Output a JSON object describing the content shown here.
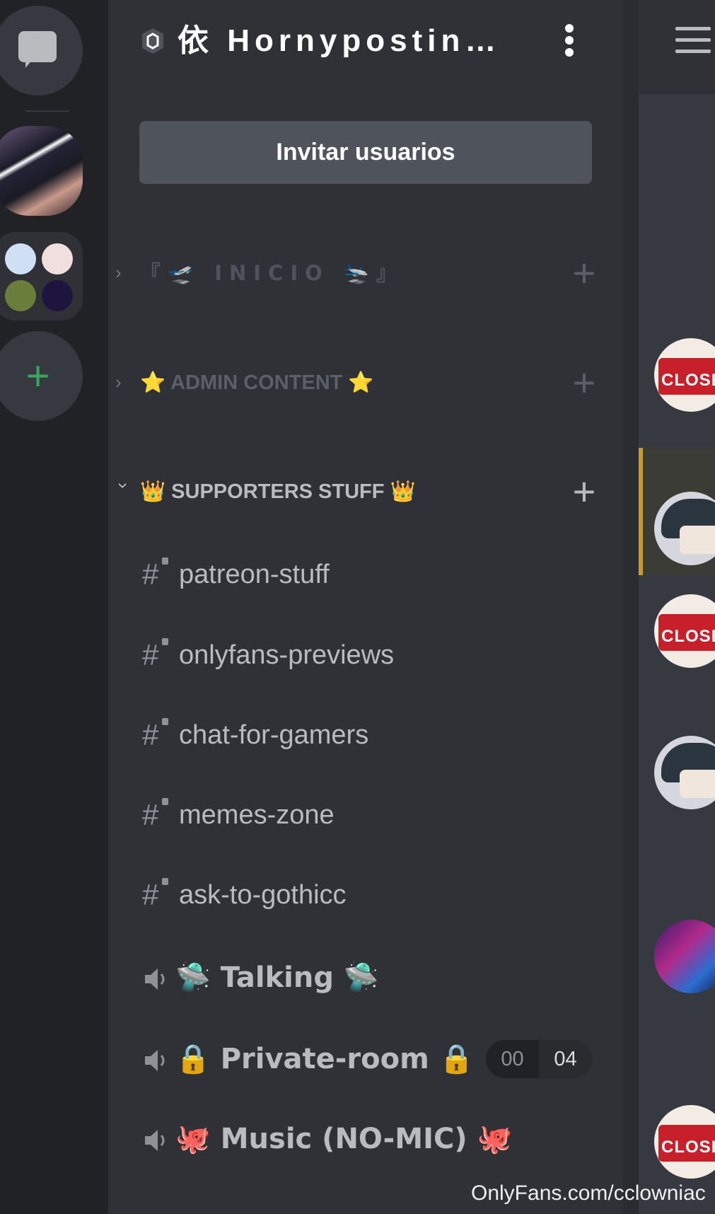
{
  "server": {
    "name": "依 Hornypostin…",
    "invite_label": "Invitar usuarios"
  },
  "categories": [
    {
      "label": "『🛫 INICIO 🛬』",
      "collapsed": true
    },
    {
      "label": "⭐ ADMIN CONTENT ⭐",
      "collapsed": true
    },
    {
      "label": "👑 SUPPORTERS STUFF 👑",
      "collapsed": false
    }
  ],
  "text_channels": [
    {
      "label": "patreon-stuff",
      "locked": true
    },
    {
      "label": "onlyfans-previews",
      "locked": true
    },
    {
      "label": "chat-for-gamers",
      "locked": true
    },
    {
      "label": "memes-zone",
      "locked": true
    },
    {
      "label": "ask-to-gothicc",
      "locked": true
    }
  ],
  "voice_channels": [
    {
      "label": "🛸 Talking 🛸"
    },
    {
      "label": "🔒 Private-room 🔒",
      "user_count": "00",
      "user_limit": "04"
    },
    {
      "label": "🐙 Music (NO-MIC) 🐙"
    }
  ],
  "icons": {
    "direct_messages": "chat-bubble-icon",
    "add_server": "plus-icon",
    "server_badge": "shield-icon",
    "menu": "kebab-icon",
    "members": "hamburger-icon",
    "voice": "speaker-icon",
    "text": "hash-lock-icon"
  },
  "colors": {
    "accent_green": "#3ba55d",
    "panel": "#2f3136",
    "rail": "#202225",
    "invite_button": "#4f545c"
  },
  "avatars_text": {
    "closed_sign": "CLOSED"
  },
  "watermark": "OnlyFans.com/cclowniac"
}
